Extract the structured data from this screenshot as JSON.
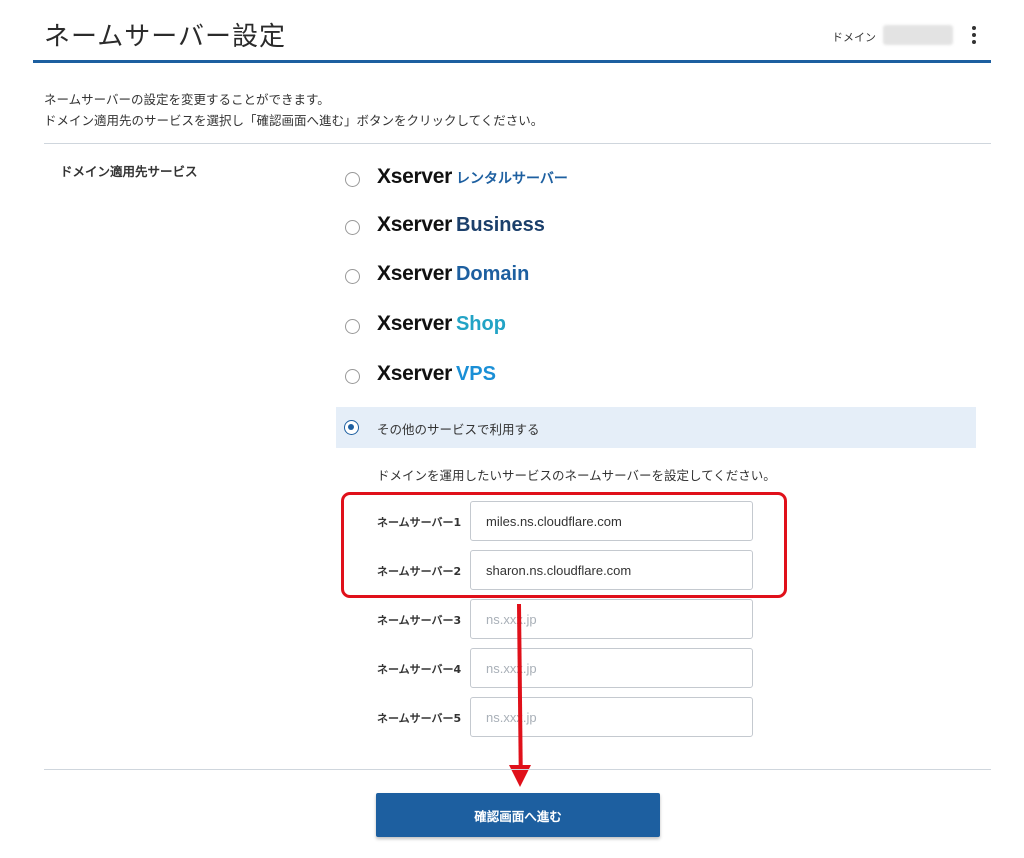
{
  "header": {
    "title": "ネームサーバー設定",
    "domain_label": "ドメイン"
  },
  "description": {
    "line1": "ネームサーバーの設定を変更することができます。",
    "line2": "ドメイン適用先のサービスを選択し「確認画面へ進む」ボタンをクリックしてください。"
  },
  "section": {
    "label": "ドメイン適用先サービス"
  },
  "services": [
    {
      "brand": "Xserver",
      "name": "レンタルサーバー",
      "color": "#1d5fa0",
      "selected": false
    },
    {
      "brand": "Xserver",
      "name": "Business",
      "color": "#1b3f6b",
      "selected": false
    },
    {
      "brand": "Xserver",
      "name": "Domain",
      "color": "#1d5fa0",
      "selected": false
    },
    {
      "brand": "Xserver",
      "name": "Shop",
      "color": "#22a3c5",
      "selected": false
    },
    {
      "brand": "Xserver",
      "name": "VPS",
      "color": "#1a8fd6",
      "selected": false
    }
  ],
  "other_service": {
    "label": "その他のサービスで利用する",
    "selected": true
  },
  "nameservers": {
    "instruction": "ドメインを運用したいサービスのネームサーバーを設定してください。",
    "fields": [
      {
        "label": "ネームサーバー1",
        "value": "miles.ns.cloudflare.com",
        "placeholder": "ns.xxx.jp"
      },
      {
        "label": "ネームサーバー2",
        "value": "sharon.ns.cloudflare.com",
        "placeholder": "ns.xxx.jp"
      },
      {
        "label": "ネームサーバー3",
        "value": "",
        "placeholder": "ns.xxx.jp"
      },
      {
        "label": "ネームサーバー4",
        "value": "",
        "placeholder": "ns.xxx.jp"
      },
      {
        "label": "ネームサーバー5",
        "value": "",
        "placeholder": "ns.xxx.jp"
      }
    ]
  },
  "submit_label": "確認画面へ進む",
  "colors": {
    "primary": "#1d5fa0",
    "highlight": "#e0101a",
    "selected_row_bg": "#e5eef8"
  },
  "icons": [
    "kebab-menu-icon",
    "radio-icon",
    "arrow-down-icon"
  ]
}
